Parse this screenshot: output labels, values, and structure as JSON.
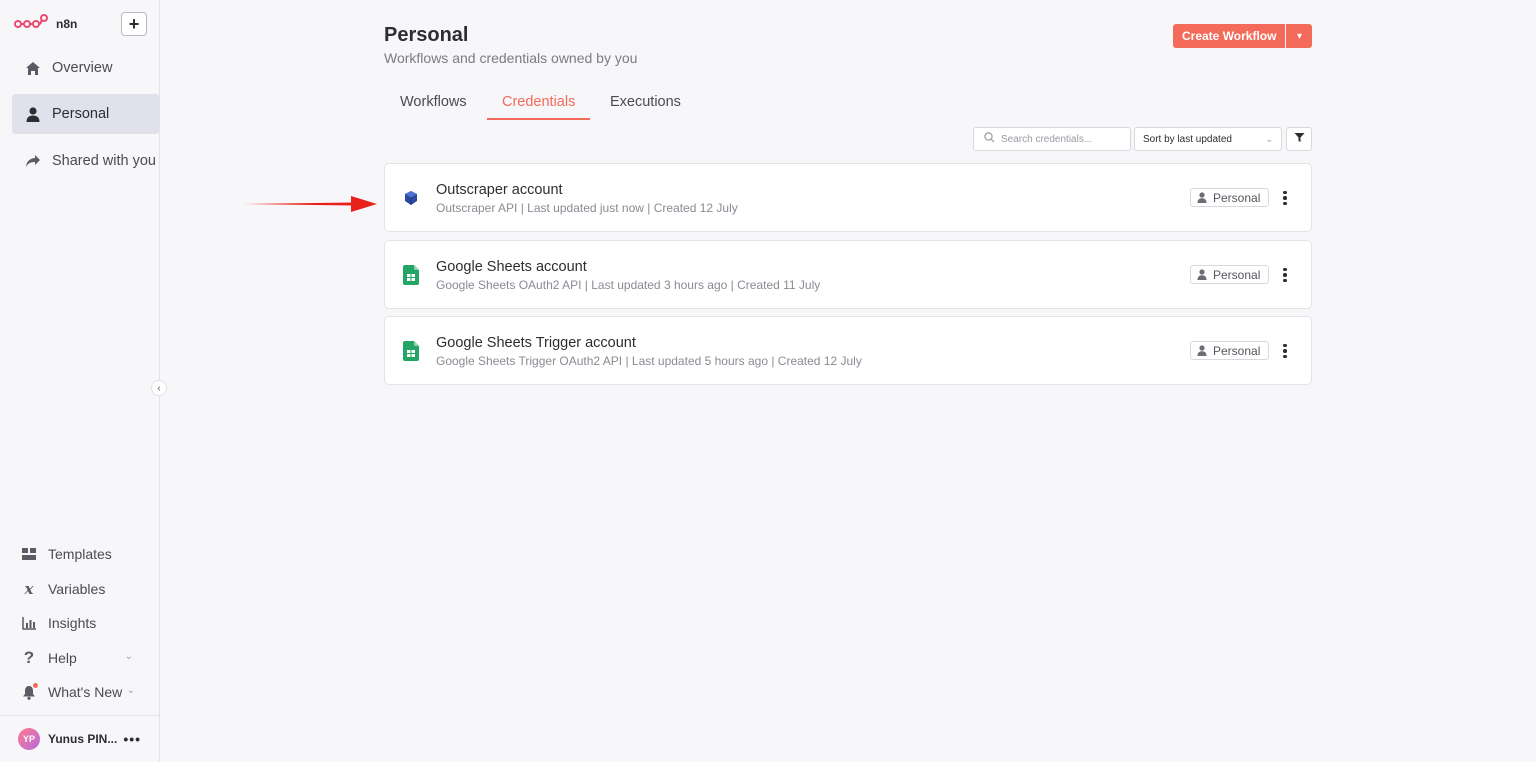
{
  "brand": {
    "name": "n8n"
  },
  "sidebar": {
    "nav": [
      {
        "label": "Overview",
        "icon": "home-icon"
      },
      {
        "label": "Personal",
        "icon": "user-icon"
      },
      {
        "label": "Shared with you",
        "icon": "share-icon"
      }
    ],
    "bottom": [
      {
        "label": "Templates",
        "icon": "templates-icon"
      },
      {
        "label": "Variables",
        "icon": "variables-icon"
      },
      {
        "label": "Insights",
        "icon": "insights-icon"
      },
      {
        "label": "Help",
        "icon": "help-icon"
      },
      {
        "label": "What's New",
        "icon": "bell-icon"
      }
    ],
    "user": {
      "initials": "YP",
      "name": "Yunus PIN..."
    }
  },
  "header": {
    "title": "Personal",
    "subtitle": "Workflows and credentials owned by you",
    "create_label": "Create Workflow"
  },
  "tabs": [
    {
      "label": "Workflows",
      "active": false
    },
    {
      "label": "Credentials",
      "active": true
    },
    {
      "label": "Executions",
      "active": false
    }
  ],
  "toolbar": {
    "search_placeholder": "Search credentials...",
    "sort_value": "Sort by last updated"
  },
  "credentials": [
    {
      "name": "Outscraper account",
      "meta": "Outscraper API | Last updated just now | Created 12 July",
      "owner": "Personal",
      "icon": "outscraper-icon"
    },
    {
      "name": "Google Sheets account",
      "meta": "Google Sheets OAuth2 API | Last updated 3 hours ago | Created 11 July",
      "owner": "Personal",
      "icon": "google-sheets-icon"
    },
    {
      "name": "Google Sheets Trigger account",
      "meta": "Google Sheets Trigger OAuth2 API | Last updated 5 hours ago | Created 12 July",
      "owner": "Personal",
      "icon": "google-sheets-icon"
    }
  ],
  "colors": {
    "accent": "#f46a5b",
    "arrow": "#e8211b",
    "sheets_green": "#23a566"
  }
}
